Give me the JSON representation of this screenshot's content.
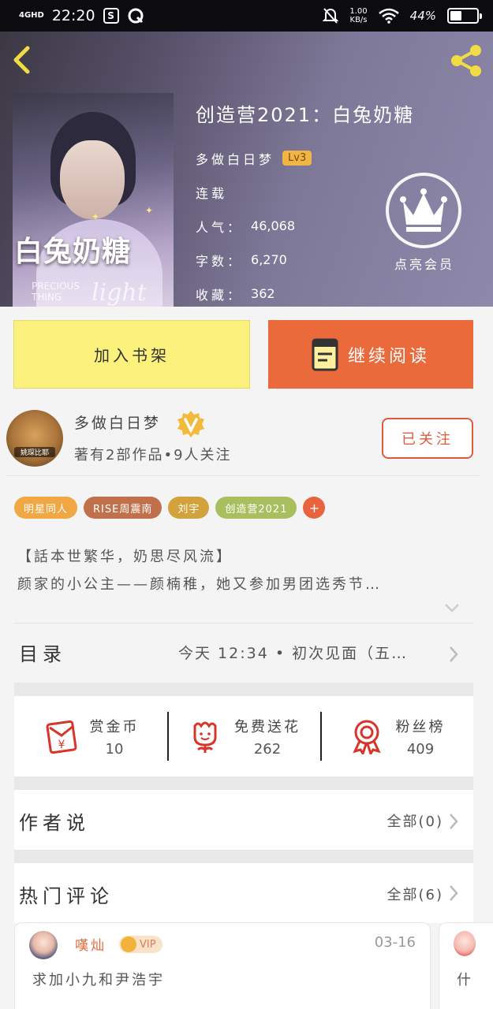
{
  "status_bar": {
    "network": "4GHD",
    "time": "22:20",
    "app_icon_letter": "S",
    "speed_value": "1.00",
    "speed_unit": "KB/s",
    "battery": "44%"
  },
  "book": {
    "title": "创造营2021：白兔奶糖",
    "cover_title": "白兔奶糖",
    "cover_sub_en": "PRECIOUS THING",
    "cover_script": "light",
    "author": "多做白日梦",
    "level": "Lv3",
    "status": "连载",
    "stats": [
      {
        "label": "人气：",
        "value": "46,068"
      },
      {
        "label": "字数：",
        "value": "6,270"
      },
      {
        "label": "收藏：",
        "value": "362"
      }
    ]
  },
  "vip": {
    "label": "点亮会员"
  },
  "actions": {
    "add_shelf": "加入书架",
    "continue_read": "继续阅读"
  },
  "author": {
    "avatar_caption": "姚琛比耶",
    "name": "多做白日梦",
    "meta": "著有2部作品•9人关注",
    "follow_label": "已关注"
  },
  "tags": [
    {
      "label": "明星同人",
      "color": "#f0a744"
    },
    {
      "label": "RISE周震南",
      "color": "#c0704a"
    },
    {
      "label": "刘宇",
      "color": "#d4a23c"
    },
    {
      "label": "创造营2021",
      "color": "#a9be5e"
    }
  ],
  "intro": {
    "line1": "【話本世繁华，奶思尽风流】",
    "line2": "颜家的小公主——颜楠稚，她又参加男团选秀节…"
  },
  "catalog": {
    "label": "目录",
    "latest": "今天 12:34 • 初次见面（五…"
  },
  "rewards": [
    {
      "icon": "red-envelope-icon",
      "label": "赏金币",
      "value": "10"
    },
    {
      "icon": "flower-icon",
      "label": "免费送花",
      "value": "262"
    },
    {
      "icon": "award-ribbon-icon",
      "label": "粉丝榜",
      "value": "409"
    }
  ],
  "author_says": {
    "label": "作者说",
    "more": "全部(0)"
  },
  "hot_comments": {
    "label": "热门评论",
    "more": "全部(6)",
    "items": [
      {
        "user": "嘆灿",
        "badge": "VIP",
        "date": "03-16",
        "text": "求加小九和尹浩宇"
      },
      {
        "text": "什"
      }
    ]
  },
  "colors": {
    "accent_orange": "#eb6a3c",
    "shelf_yellow": "#fbf17c",
    "follow_red": "#dd5b3e"
  }
}
